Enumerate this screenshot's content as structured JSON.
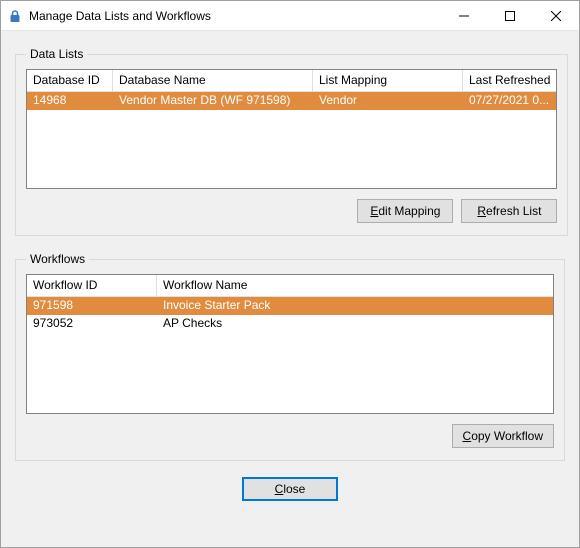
{
  "window": {
    "title": "Manage Data Lists and Workflows"
  },
  "dataLists": {
    "legend": "Data Lists",
    "columns": [
      "Database ID",
      "Database Name",
      "List Mapping",
      "Last Refreshed"
    ],
    "rows": [
      {
        "selected": true,
        "database_id": "14968",
        "database_name": "Vendor Master DB (WF 971598)",
        "list_mapping": "Vendor",
        "last_refreshed": "07/27/2021 0..."
      }
    ],
    "buttons": {
      "edit_mapping": "Edit Mapping",
      "refresh_list": "Refresh List"
    }
  },
  "workflows": {
    "legend": "Workflows",
    "columns": [
      "Workflow ID",
      "Workflow Name"
    ],
    "rows": [
      {
        "selected": true,
        "workflow_id": "971598",
        "workflow_name": "Invoice Starter Pack"
      },
      {
        "selected": false,
        "workflow_id": "973052",
        "workflow_name": "AP Checks"
      }
    ],
    "buttons": {
      "copy_workflow": "Copy Workflow"
    }
  },
  "footer": {
    "close": "Close"
  }
}
